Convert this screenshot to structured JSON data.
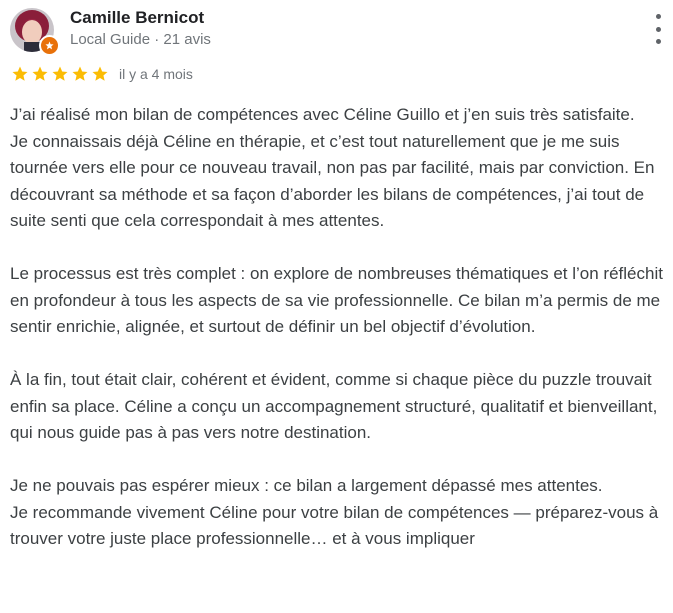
{
  "reviewer": {
    "name": "Camille Bernicot",
    "meta": "Local Guide · 21 avis"
  },
  "rating": {
    "stars": 5,
    "max": 5,
    "color": "#fbbc04",
    "date": "il y a 4 mois"
  },
  "colors": {
    "guide_badge": "#e8710a"
  },
  "review": {
    "paragraphs": [
      "J’ai réalisé mon bilan de compétences avec Céline Guillo et j’en suis très satisfaite.\nJe connaissais déjà Céline en thérapie, et c’est tout naturellement que je me suis tournée vers elle pour ce nouveau travail, non pas par facilité, mais par conviction. En découvrant sa méthode et sa façon d’aborder les bilans de compétences, j’ai tout de suite senti que cela correspondait à mes attentes.",
      "Le processus est très complet : on explore de nombreuses thématiques et l’on réfléchit en profondeur à tous les aspects de sa vie professionnelle. Ce bilan m’a permis de me sentir enrichie, alignée, et surtout de définir un bel objectif d’évolution.",
      "À la fin, tout était clair, cohérent et évident, comme si chaque pièce du puzzle trouvait enfin sa place. Céline a conçu un accompagnement structuré, qualitatif et bienveillant, qui nous guide pas à pas vers notre destination.",
      "Je ne pouvais pas espérer mieux : ce bilan a largement dépassé mes attentes.\nJe recommande vivement Céline pour votre bilan de compétences — préparez-vous à trouver votre juste place professionnelle… et à vous impliquer"
    ]
  }
}
